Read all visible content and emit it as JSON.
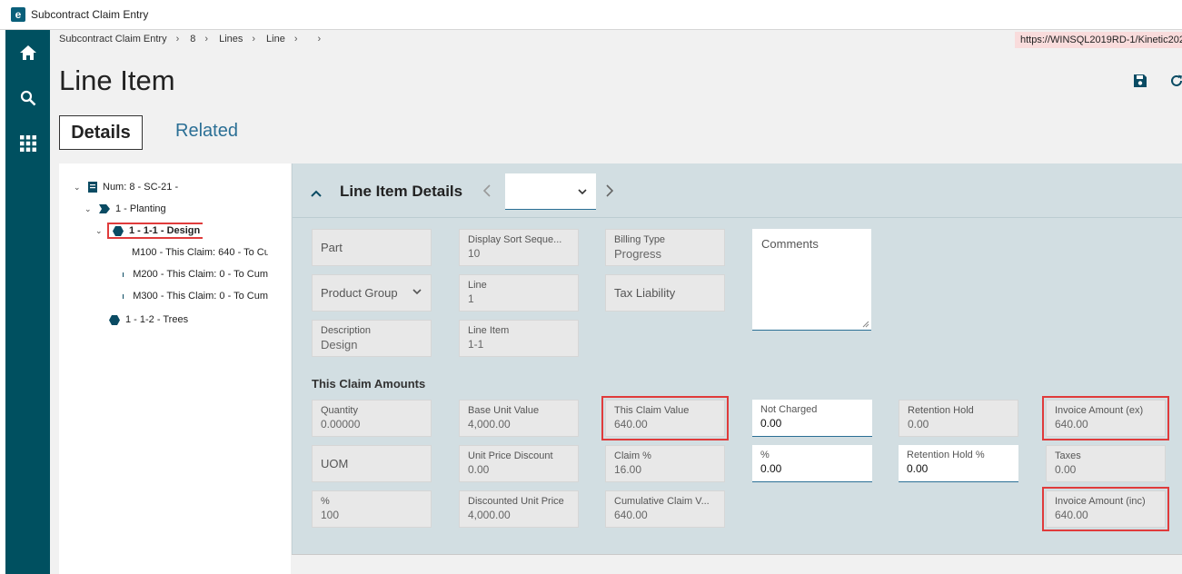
{
  "window": {
    "title": "Subcontract Claim Entry",
    "logo_letter": "e"
  },
  "breadcrumb": {
    "items": [
      "Subcontract Claim Entry",
      "8",
      "Lines",
      "Line",
      ""
    ],
    "separator": "›",
    "url": "https://WINSQL2019RD-1/Kinetic202"
  },
  "page": {
    "title": "Line Item"
  },
  "tabs": {
    "details": "Details",
    "related": "Related"
  },
  "tree": {
    "root": "Num: 8 - SC-21 -",
    "group": "1 - Planting",
    "selected": "1 - 1-1 - Design",
    "children": [
      "M100 - This Claim: 640 - To Cu",
      "M200 - This Claim: 0 - To Cum",
      "M300 - This Claim: 0 - To Cum"
    ],
    "sibling": "1 - 1-2 - Trees"
  },
  "panel": {
    "title": "Line Item Details",
    "nav_value": ""
  },
  "fields": {
    "part": {
      "label": "Part"
    },
    "display_sort": {
      "label": "Display Sort Seque...",
      "value": "10"
    },
    "billing_type": {
      "label": "Billing Type",
      "value": "Progress"
    },
    "comments": {
      "label": "Comments"
    },
    "product_group": {
      "label": "Product Group"
    },
    "line": {
      "label": "Line",
      "value": "1"
    },
    "tax_liability": {
      "label": "Tax Liability"
    },
    "description": {
      "label": "Description",
      "value": "Design"
    },
    "line_item": {
      "label": "Line Item",
      "value": "1-1"
    }
  },
  "amounts": {
    "section_title": "This Claim Amounts",
    "quantity": {
      "label": "Quantity",
      "value": "0.00000"
    },
    "base_unit_value": {
      "label": "Base Unit Value",
      "value": "4,000.00"
    },
    "this_claim_value": {
      "label": "This Claim Value",
      "value": "640.00"
    },
    "not_charged": {
      "label": "Not Charged",
      "value": "0.00"
    },
    "retention_hold": {
      "label": "Retention Hold",
      "value": "0.00"
    },
    "invoice_amount_ex": {
      "label": "Invoice Amount (ex)",
      "value": "640.00"
    },
    "uom": {
      "label": "UOM"
    },
    "unit_price_discount": {
      "label": "Unit Price Discount",
      "value": "0.00"
    },
    "claim_pct": {
      "label": "Claim %",
      "value": "16.00"
    },
    "pct": {
      "label": "%",
      "value": "0.00"
    },
    "retention_hold_pct": {
      "label": "Retention Hold %",
      "value": "0.00"
    },
    "taxes": {
      "label": "Taxes",
      "value": "0.00"
    },
    "pct2": {
      "label": "%",
      "value": "100"
    },
    "discounted_unit_price": {
      "label": "Discounted Unit Price",
      "value": "4,000.00"
    },
    "cumulative_claim": {
      "label": "Cumulative Claim V...",
      "value": "640.00"
    },
    "invoice_amount_inc": {
      "label": "Invoice Amount (inc)",
      "value": "640.00"
    }
  },
  "colors": {
    "rail": "#005060",
    "panel": "#d2dee2",
    "highlight": "#e03b3b",
    "link": "#2b6f95"
  }
}
